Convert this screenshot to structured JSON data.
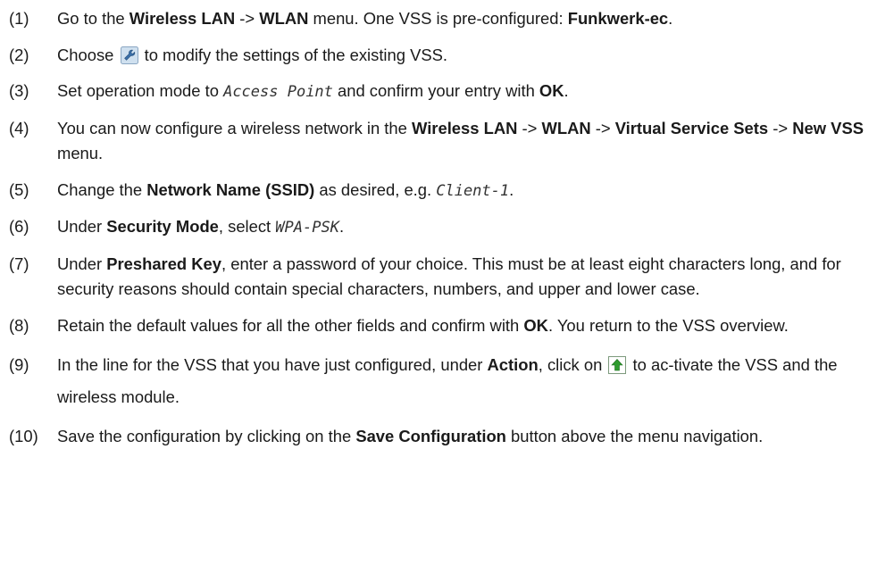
{
  "steps": [
    {
      "num": "(1)",
      "parts": [
        {
          "t": "Go to the "
        },
        {
          "b": "Wireless LAN"
        },
        {
          "t": " -> "
        },
        {
          "b": "WLAN"
        },
        {
          "t": " menu. One VSS is pre-configured: "
        },
        {
          "b": "Funkwerk-ec"
        },
        {
          "t": "."
        }
      ]
    },
    {
      "num": "(2)",
      "parts": [
        {
          "t": "Choose "
        },
        {
          "icon": "wrench-icon"
        },
        {
          "t": " to modify the settings of the existing VSS."
        }
      ]
    },
    {
      "num": "(3)",
      "parts": [
        {
          "t": "Set operation mode to "
        },
        {
          "m": "Access Point"
        },
        {
          "t": " and confirm your entry with "
        },
        {
          "b": "OK"
        },
        {
          "t": "."
        }
      ]
    },
    {
      "num": "(4)",
      "parts": [
        {
          "t": "You can now configure a wireless network in the "
        },
        {
          "b": "Wireless LAN"
        },
        {
          "t": " -> "
        },
        {
          "b": "WLAN"
        },
        {
          "t": " -> "
        },
        {
          "b": "Virtual Service Sets"
        },
        {
          "t": " -> "
        },
        {
          "b": "New VSS"
        },
        {
          "t": " menu."
        }
      ]
    },
    {
      "num": "(5)",
      "parts": [
        {
          "t": "Change the "
        },
        {
          "b": "Network Name (SSID)"
        },
        {
          "t": " as desired, e.g. "
        },
        {
          "m": "Client-1"
        },
        {
          "t": "."
        }
      ]
    },
    {
      "num": "(6)",
      "parts": [
        {
          "t": "Under "
        },
        {
          "b": "Security Mode"
        },
        {
          "t": ", select "
        },
        {
          "m": "WPA-PSK"
        },
        {
          "t": "."
        }
      ]
    },
    {
      "num": "(7)",
      "parts": [
        {
          "t": "Under "
        },
        {
          "b": "Preshared Key"
        },
        {
          "t": ", enter a password of your choice. This must be at least eight characters long, and for security reasons should contain special characters, numbers, and upper and lower case."
        }
      ]
    },
    {
      "num": "(8)",
      "parts": [
        {
          "t": "Retain the default values for all the other fields and confirm with "
        },
        {
          "b": "OK"
        },
        {
          "t": ". You return to the VSS overview."
        }
      ]
    },
    {
      "num": "(9)",
      "parts": [
        {
          "t": "In the line for the VSS that you have just configured, under "
        },
        {
          "b": "Action"
        },
        {
          "t": ", click on "
        },
        {
          "icon": "activate-arrow-icon"
        },
        {
          "t": " to ac-tivate the VSS and the wireless module."
        }
      ]
    },
    {
      "num": "(10)",
      "parts": [
        {
          "t": "Save the configuration by clicking on the "
        },
        {
          "b": "Save Configuration"
        },
        {
          "t": " button above the menu navigation."
        }
      ]
    }
  ]
}
